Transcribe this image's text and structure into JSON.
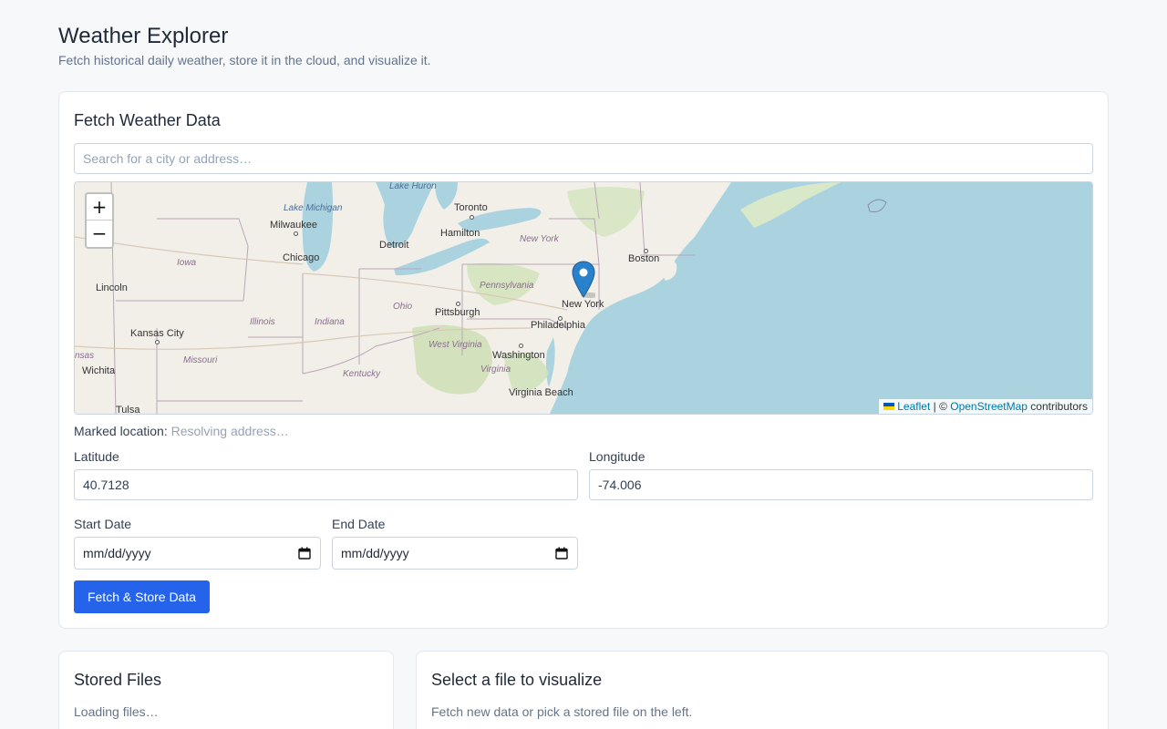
{
  "header": {
    "title": "Weather Explorer",
    "subtitle": "Fetch historical daily weather, store it in the cloud, and visualize it."
  },
  "fetch_card": {
    "title": "Fetch Weather Data",
    "search_placeholder": "Search for a city or address…",
    "map": {
      "zoom_in": "+",
      "zoom_out": "−",
      "attribution_leaflet": "Leaflet",
      "attribution_sep": " | © ",
      "attribution_osm": "OpenStreetMap",
      "attribution_tail": " contributors",
      "cities": [
        "Milwaukee",
        "Chicago",
        "Detroit",
        "Toronto",
        "Hamilton",
        "Boston",
        "New York",
        "Philadelphia",
        "Pittsburgh",
        "Washington",
        "Virginia Beach",
        "Lincoln",
        "Kansas City",
        "Wichita",
        "Tulsa"
      ],
      "regions": [
        "Iowa",
        "Illinois",
        "Indiana",
        "Ohio",
        "Pennsylvania",
        "New York",
        "West Virginia",
        "Virginia",
        "Kentucky",
        "Missouri",
        "nsas"
      ],
      "waters": [
        "Lake Michigan",
        "Lake Huron"
      ]
    },
    "marked_label": "Marked location:",
    "marked_status": "Resolving address…",
    "latitude_label": "Latitude",
    "latitude_value": "40.7128",
    "longitude_label": "Longitude",
    "longitude_value": "-74.006",
    "start_label": "Start Date",
    "start_placeholder": "mm/dd/yyyy",
    "end_label": "End Date",
    "end_placeholder": "mm/dd/yyyy",
    "submit_label": "Fetch & Store Data"
  },
  "stored_files": {
    "title": "Stored Files",
    "status": "Loading files…"
  },
  "visualize": {
    "title": "Select a file to visualize",
    "hint": "Fetch new data or pick a stored file on the left."
  },
  "colors": {
    "primary": "#2563eb",
    "water": "#aad3df",
    "land": "#f2efe9",
    "marker": "#2a81cb"
  }
}
